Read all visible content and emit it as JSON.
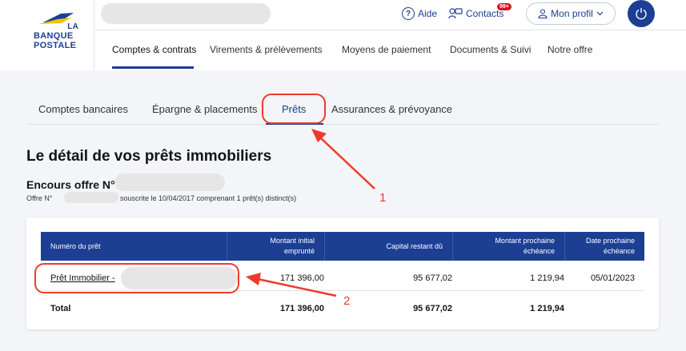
{
  "brand": {
    "line1": "LA",
    "line2": "BANQUE",
    "line3": "POSTALE",
    "color": "#1c3f94"
  },
  "header": {
    "aide_label": "Aide",
    "contacts_label": "Contacts",
    "contacts_badge": "99+",
    "profile_label": "Mon profil"
  },
  "main_nav": [
    {
      "label": "Comptes & contrats",
      "active": true
    },
    {
      "label": "Virements & prélèvements"
    },
    {
      "label": "Moyens de paiement"
    },
    {
      "label": "Documents & Suivi"
    },
    {
      "label": "Notre offre"
    }
  ],
  "sub_tabs": [
    {
      "label": "Comptes bancaires"
    },
    {
      "label": "Épargne & placements"
    },
    {
      "label": "Prêts",
      "active": true
    },
    {
      "label": "Assurances & prévoyance"
    }
  ],
  "page_title": "Le détail de vos prêts immobiliers",
  "offer": {
    "title": "Encours offre N°",
    "line_prefix": "Offre N°",
    "line_suffix": "souscrite le 10/04/2017 comprenant 1 prêt(s) distinct(s)"
  },
  "table": {
    "headers": {
      "numero": "Numéro du prêt",
      "montant_line1": "Montant initial",
      "montant_line2": "emprunté",
      "capital": "Capital restant dû",
      "echeance_line1": "Montant prochaine",
      "echeance_line2": "échéance",
      "date_line1": "Date prochaine",
      "date_line2": "échéance"
    },
    "rows": [
      {
        "name": "Prêt Immobilier -",
        "montant": "171 396,00",
        "capital": "95 677,02",
        "echeance": "1 219,94",
        "date": "05/01/2023"
      }
    ],
    "total": {
      "label": "Total",
      "montant": "171 396,00",
      "capital": "95 677,02",
      "echeance": "1 219,94"
    }
  },
  "annotations": {
    "one": "1",
    "two": "2",
    "color": "#ee3a2a"
  }
}
